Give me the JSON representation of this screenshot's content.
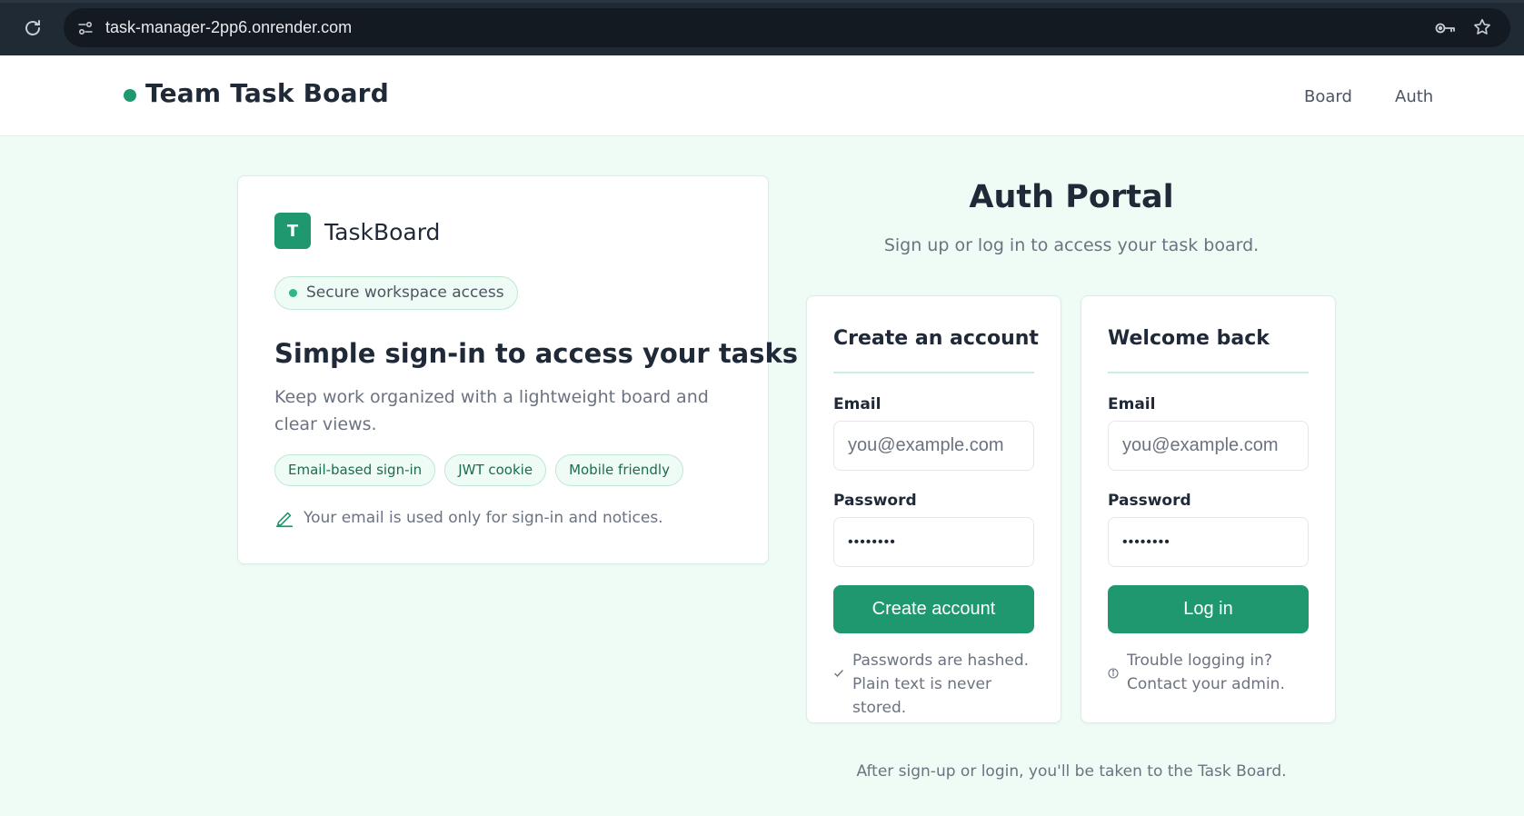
{
  "browser": {
    "url": "task-manager-2pp6.onrender.com",
    "icons": {
      "reload": "reload-icon",
      "site_info": "site-info-icon",
      "key": "key-icon",
      "bookmark": "star-icon"
    }
  },
  "header": {
    "title": "Team Task Board",
    "nav": [
      {
        "label": "Board"
      },
      {
        "label": "Auth"
      }
    ]
  },
  "info_card": {
    "logo_letter": "T",
    "logo_name": "TaskBoard",
    "pill": "Secure workspace access",
    "heading": "Simple sign-in to access your tasks",
    "description": "Keep work organized with a lightweight board and clear views.",
    "chips": [
      "Email-based sign-in",
      "JWT cookie",
      "Mobile friendly"
    ],
    "note": "Your email is used only for sign-in and notices.",
    "note_icon": "pen-icon"
  },
  "portal": {
    "title": "Auth Portal",
    "subtitle": "Sign up or log in to access your task board.",
    "signup": {
      "title": "Create an account",
      "email_label": "Email",
      "email_placeholder": "you@example.com",
      "password_label": "Password",
      "password_value": "••••••••",
      "button": "Create account",
      "note": "Passwords are hashed. Plain text is never stored.",
      "note_icon": "check-icon"
    },
    "login": {
      "title": "Welcome back",
      "email_label": "Email",
      "email_placeholder": "you@example.com",
      "password_label": "Password",
      "password_value": "••••••••",
      "button": "Log in",
      "note": "Trouble logging in? Contact your admin.",
      "note_icon": "info-icon"
    },
    "footer_note": "After sign-up or login, you'll be taken to the Task Board."
  },
  "colors": {
    "accent": "#1f9870",
    "page_background": "#effbf5",
    "browser_chrome": "#202a35"
  }
}
